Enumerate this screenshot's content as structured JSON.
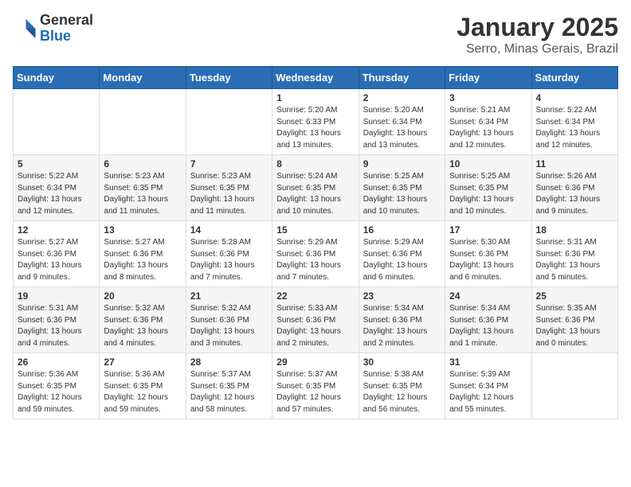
{
  "logo": {
    "line1": "General",
    "line2": "Blue"
  },
  "title": "January 2025",
  "subtitle": "Serro, Minas Gerais, Brazil",
  "days_of_week": [
    "Sunday",
    "Monday",
    "Tuesday",
    "Wednesday",
    "Thursday",
    "Friday",
    "Saturday"
  ],
  "weeks": [
    [
      {
        "day": "",
        "info": ""
      },
      {
        "day": "",
        "info": ""
      },
      {
        "day": "",
        "info": ""
      },
      {
        "day": "1",
        "info": "Sunrise: 5:20 AM\nSunset: 6:33 PM\nDaylight: 13 hours\nand 13 minutes."
      },
      {
        "day": "2",
        "info": "Sunrise: 5:20 AM\nSunset: 6:34 PM\nDaylight: 13 hours\nand 13 minutes."
      },
      {
        "day": "3",
        "info": "Sunrise: 5:21 AM\nSunset: 6:34 PM\nDaylight: 13 hours\nand 12 minutes."
      },
      {
        "day": "4",
        "info": "Sunrise: 5:22 AM\nSunset: 6:34 PM\nDaylight: 13 hours\nand 12 minutes."
      }
    ],
    [
      {
        "day": "5",
        "info": "Sunrise: 5:22 AM\nSunset: 6:34 PM\nDaylight: 13 hours\nand 12 minutes."
      },
      {
        "day": "6",
        "info": "Sunrise: 5:23 AM\nSunset: 6:35 PM\nDaylight: 13 hours\nand 11 minutes."
      },
      {
        "day": "7",
        "info": "Sunrise: 5:23 AM\nSunset: 6:35 PM\nDaylight: 13 hours\nand 11 minutes."
      },
      {
        "day": "8",
        "info": "Sunrise: 5:24 AM\nSunset: 6:35 PM\nDaylight: 13 hours\nand 10 minutes."
      },
      {
        "day": "9",
        "info": "Sunrise: 5:25 AM\nSunset: 6:35 PM\nDaylight: 13 hours\nand 10 minutes."
      },
      {
        "day": "10",
        "info": "Sunrise: 5:25 AM\nSunset: 6:35 PM\nDaylight: 13 hours\nand 10 minutes."
      },
      {
        "day": "11",
        "info": "Sunrise: 5:26 AM\nSunset: 6:36 PM\nDaylight: 13 hours\nand 9 minutes."
      }
    ],
    [
      {
        "day": "12",
        "info": "Sunrise: 5:27 AM\nSunset: 6:36 PM\nDaylight: 13 hours\nand 9 minutes."
      },
      {
        "day": "13",
        "info": "Sunrise: 5:27 AM\nSunset: 6:36 PM\nDaylight: 13 hours\nand 8 minutes."
      },
      {
        "day": "14",
        "info": "Sunrise: 5:28 AM\nSunset: 6:36 PM\nDaylight: 13 hours\nand 7 minutes."
      },
      {
        "day": "15",
        "info": "Sunrise: 5:29 AM\nSunset: 6:36 PM\nDaylight: 13 hours\nand 7 minutes."
      },
      {
        "day": "16",
        "info": "Sunrise: 5:29 AM\nSunset: 6:36 PM\nDaylight: 13 hours\nand 6 minutes."
      },
      {
        "day": "17",
        "info": "Sunrise: 5:30 AM\nSunset: 6:36 PM\nDaylight: 13 hours\nand 6 minutes."
      },
      {
        "day": "18",
        "info": "Sunrise: 5:31 AM\nSunset: 6:36 PM\nDaylight: 13 hours\nand 5 minutes."
      }
    ],
    [
      {
        "day": "19",
        "info": "Sunrise: 5:31 AM\nSunset: 6:36 PM\nDaylight: 13 hours\nand 4 minutes."
      },
      {
        "day": "20",
        "info": "Sunrise: 5:32 AM\nSunset: 6:36 PM\nDaylight: 13 hours\nand 4 minutes."
      },
      {
        "day": "21",
        "info": "Sunrise: 5:32 AM\nSunset: 6:36 PM\nDaylight: 13 hours\nand 3 minutes."
      },
      {
        "day": "22",
        "info": "Sunrise: 5:33 AM\nSunset: 6:36 PM\nDaylight: 13 hours\nand 2 minutes."
      },
      {
        "day": "23",
        "info": "Sunrise: 5:34 AM\nSunset: 6:36 PM\nDaylight: 13 hours\nand 2 minutes."
      },
      {
        "day": "24",
        "info": "Sunrise: 5:34 AM\nSunset: 6:36 PM\nDaylight: 13 hours\nand 1 minute."
      },
      {
        "day": "25",
        "info": "Sunrise: 5:35 AM\nSunset: 6:36 PM\nDaylight: 13 hours\nand 0 minutes."
      }
    ],
    [
      {
        "day": "26",
        "info": "Sunrise: 5:36 AM\nSunset: 6:35 PM\nDaylight: 12 hours\nand 59 minutes."
      },
      {
        "day": "27",
        "info": "Sunrise: 5:36 AM\nSunset: 6:35 PM\nDaylight: 12 hours\nand 59 minutes."
      },
      {
        "day": "28",
        "info": "Sunrise: 5:37 AM\nSunset: 6:35 PM\nDaylight: 12 hours\nand 58 minutes."
      },
      {
        "day": "29",
        "info": "Sunrise: 5:37 AM\nSunset: 6:35 PM\nDaylight: 12 hours\nand 57 minutes."
      },
      {
        "day": "30",
        "info": "Sunrise: 5:38 AM\nSunset: 6:35 PM\nDaylight: 12 hours\nand 56 minutes."
      },
      {
        "day": "31",
        "info": "Sunrise: 5:39 AM\nSunset: 6:34 PM\nDaylight: 12 hours\nand 55 minutes."
      },
      {
        "day": "",
        "info": ""
      }
    ]
  ]
}
